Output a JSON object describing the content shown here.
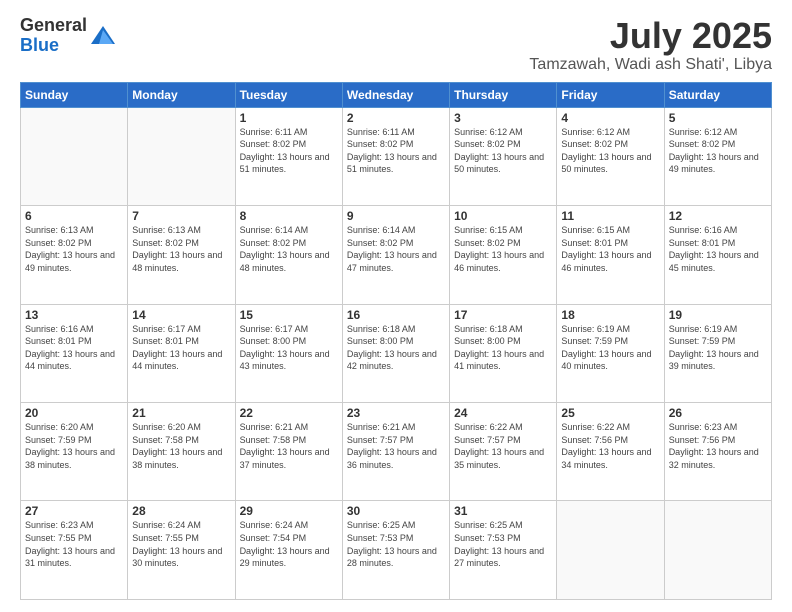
{
  "logo": {
    "general": "General",
    "blue": "Blue"
  },
  "title": {
    "month": "July 2025",
    "location": "Tamzawah, Wadi ash Shati', Libya"
  },
  "weekdays": [
    "Sunday",
    "Monday",
    "Tuesday",
    "Wednesday",
    "Thursday",
    "Friday",
    "Saturday"
  ],
  "weeks": [
    [
      {
        "day": "",
        "sunrise": "",
        "sunset": "",
        "daylight": ""
      },
      {
        "day": "",
        "sunrise": "",
        "sunset": "",
        "daylight": ""
      },
      {
        "day": "1",
        "sunrise": "Sunrise: 6:11 AM",
        "sunset": "Sunset: 8:02 PM",
        "daylight": "Daylight: 13 hours and 51 minutes."
      },
      {
        "day": "2",
        "sunrise": "Sunrise: 6:11 AM",
        "sunset": "Sunset: 8:02 PM",
        "daylight": "Daylight: 13 hours and 51 minutes."
      },
      {
        "day": "3",
        "sunrise": "Sunrise: 6:12 AM",
        "sunset": "Sunset: 8:02 PM",
        "daylight": "Daylight: 13 hours and 50 minutes."
      },
      {
        "day": "4",
        "sunrise": "Sunrise: 6:12 AM",
        "sunset": "Sunset: 8:02 PM",
        "daylight": "Daylight: 13 hours and 50 minutes."
      },
      {
        "day": "5",
        "sunrise": "Sunrise: 6:12 AM",
        "sunset": "Sunset: 8:02 PM",
        "daylight": "Daylight: 13 hours and 49 minutes."
      }
    ],
    [
      {
        "day": "6",
        "sunrise": "Sunrise: 6:13 AM",
        "sunset": "Sunset: 8:02 PM",
        "daylight": "Daylight: 13 hours and 49 minutes."
      },
      {
        "day": "7",
        "sunrise": "Sunrise: 6:13 AM",
        "sunset": "Sunset: 8:02 PM",
        "daylight": "Daylight: 13 hours and 48 minutes."
      },
      {
        "day": "8",
        "sunrise": "Sunrise: 6:14 AM",
        "sunset": "Sunset: 8:02 PM",
        "daylight": "Daylight: 13 hours and 48 minutes."
      },
      {
        "day": "9",
        "sunrise": "Sunrise: 6:14 AM",
        "sunset": "Sunset: 8:02 PM",
        "daylight": "Daylight: 13 hours and 47 minutes."
      },
      {
        "day": "10",
        "sunrise": "Sunrise: 6:15 AM",
        "sunset": "Sunset: 8:02 PM",
        "daylight": "Daylight: 13 hours and 46 minutes."
      },
      {
        "day": "11",
        "sunrise": "Sunrise: 6:15 AM",
        "sunset": "Sunset: 8:01 PM",
        "daylight": "Daylight: 13 hours and 46 minutes."
      },
      {
        "day": "12",
        "sunrise": "Sunrise: 6:16 AM",
        "sunset": "Sunset: 8:01 PM",
        "daylight": "Daylight: 13 hours and 45 minutes."
      }
    ],
    [
      {
        "day": "13",
        "sunrise": "Sunrise: 6:16 AM",
        "sunset": "Sunset: 8:01 PM",
        "daylight": "Daylight: 13 hours and 44 minutes."
      },
      {
        "day": "14",
        "sunrise": "Sunrise: 6:17 AM",
        "sunset": "Sunset: 8:01 PM",
        "daylight": "Daylight: 13 hours and 44 minutes."
      },
      {
        "day": "15",
        "sunrise": "Sunrise: 6:17 AM",
        "sunset": "Sunset: 8:00 PM",
        "daylight": "Daylight: 13 hours and 43 minutes."
      },
      {
        "day": "16",
        "sunrise": "Sunrise: 6:18 AM",
        "sunset": "Sunset: 8:00 PM",
        "daylight": "Daylight: 13 hours and 42 minutes."
      },
      {
        "day": "17",
        "sunrise": "Sunrise: 6:18 AM",
        "sunset": "Sunset: 8:00 PM",
        "daylight": "Daylight: 13 hours and 41 minutes."
      },
      {
        "day": "18",
        "sunrise": "Sunrise: 6:19 AM",
        "sunset": "Sunset: 7:59 PM",
        "daylight": "Daylight: 13 hours and 40 minutes."
      },
      {
        "day": "19",
        "sunrise": "Sunrise: 6:19 AM",
        "sunset": "Sunset: 7:59 PM",
        "daylight": "Daylight: 13 hours and 39 minutes."
      }
    ],
    [
      {
        "day": "20",
        "sunrise": "Sunrise: 6:20 AM",
        "sunset": "Sunset: 7:59 PM",
        "daylight": "Daylight: 13 hours and 38 minutes."
      },
      {
        "day": "21",
        "sunrise": "Sunrise: 6:20 AM",
        "sunset": "Sunset: 7:58 PM",
        "daylight": "Daylight: 13 hours and 38 minutes."
      },
      {
        "day": "22",
        "sunrise": "Sunrise: 6:21 AM",
        "sunset": "Sunset: 7:58 PM",
        "daylight": "Daylight: 13 hours and 37 minutes."
      },
      {
        "day": "23",
        "sunrise": "Sunrise: 6:21 AM",
        "sunset": "Sunset: 7:57 PM",
        "daylight": "Daylight: 13 hours and 36 minutes."
      },
      {
        "day": "24",
        "sunrise": "Sunrise: 6:22 AM",
        "sunset": "Sunset: 7:57 PM",
        "daylight": "Daylight: 13 hours and 35 minutes."
      },
      {
        "day": "25",
        "sunrise": "Sunrise: 6:22 AM",
        "sunset": "Sunset: 7:56 PM",
        "daylight": "Daylight: 13 hours and 34 minutes."
      },
      {
        "day": "26",
        "sunrise": "Sunrise: 6:23 AM",
        "sunset": "Sunset: 7:56 PM",
        "daylight": "Daylight: 13 hours and 32 minutes."
      }
    ],
    [
      {
        "day": "27",
        "sunrise": "Sunrise: 6:23 AM",
        "sunset": "Sunset: 7:55 PM",
        "daylight": "Daylight: 13 hours and 31 minutes."
      },
      {
        "day": "28",
        "sunrise": "Sunrise: 6:24 AM",
        "sunset": "Sunset: 7:55 PM",
        "daylight": "Daylight: 13 hours and 30 minutes."
      },
      {
        "day": "29",
        "sunrise": "Sunrise: 6:24 AM",
        "sunset": "Sunset: 7:54 PM",
        "daylight": "Daylight: 13 hours and 29 minutes."
      },
      {
        "day": "30",
        "sunrise": "Sunrise: 6:25 AM",
        "sunset": "Sunset: 7:53 PM",
        "daylight": "Daylight: 13 hours and 28 minutes."
      },
      {
        "day": "31",
        "sunrise": "Sunrise: 6:25 AM",
        "sunset": "Sunset: 7:53 PM",
        "daylight": "Daylight: 13 hours and 27 minutes."
      },
      {
        "day": "",
        "sunrise": "",
        "sunset": "",
        "daylight": ""
      },
      {
        "day": "",
        "sunrise": "",
        "sunset": "",
        "daylight": ""
      }
    ]
  ]
}
